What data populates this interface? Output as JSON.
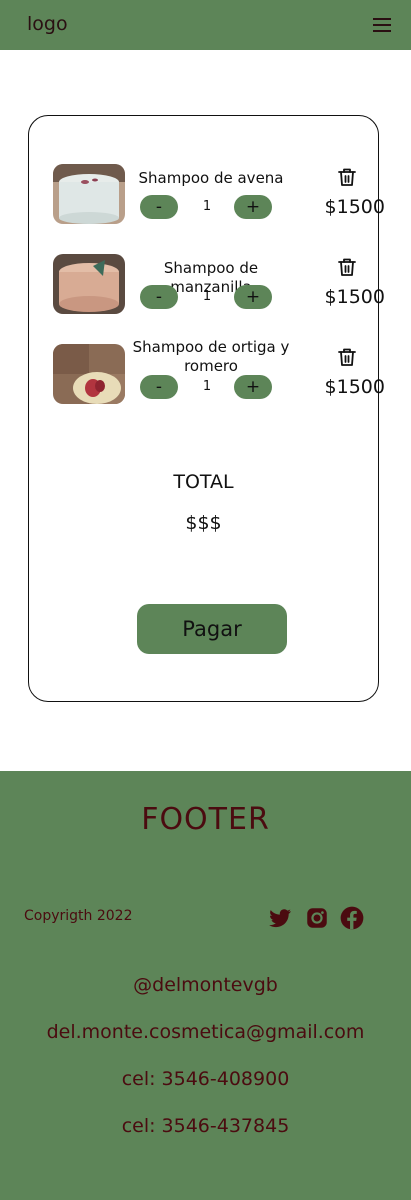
{
  "header": {
    "logo": "logo",
    "menu_icon": "hamburger-menu-icon"
  },
  "cart": {
    "items": [
      {
        "name": "Shampoo de avena",
        "quantity": "1",
        "price": "$1500",
        "minus_label": "-",
        "plus_label": "+"
      },
      {
        "name": "Shampoo de manzanilla",
        "quantity": "1",
        "price": "$1500",
        "minus_label": "-",
        "plus_label": "+"
      },
      {
        "name": "Shampoo de ortiga y romero",
        "quantity": "1",
        "price": "$1500",
        "minus_label": "-",
        "plus_label": "+"
      }
    ],
    "total_label": "TOTAL",
    "total_value": "$$$",
    "pay_button": "Pagar",
    "delete_icon": "trash-icon"
  },
  "footer": {
    "title": "FOOTER",
    "copyright": "Copyrigth 2022",
    "social_icons": [
      "twitter-icon",
      "instagram-icon",
      "facebook-icon"
    ],
    "handle": "@delmontevgb",
    "email": "del.monte.cosmetica@gmail.com",
    "phone_1": "cel: 3546-408900",
    "phone_2": "cel: 3546-437845"
  },
  "colors": {
    "brand_green": "#5d8558",
    "footer_text": "#4b0b10",
    "text": "#111111",
    "background": "#ffffff"
  }
}
